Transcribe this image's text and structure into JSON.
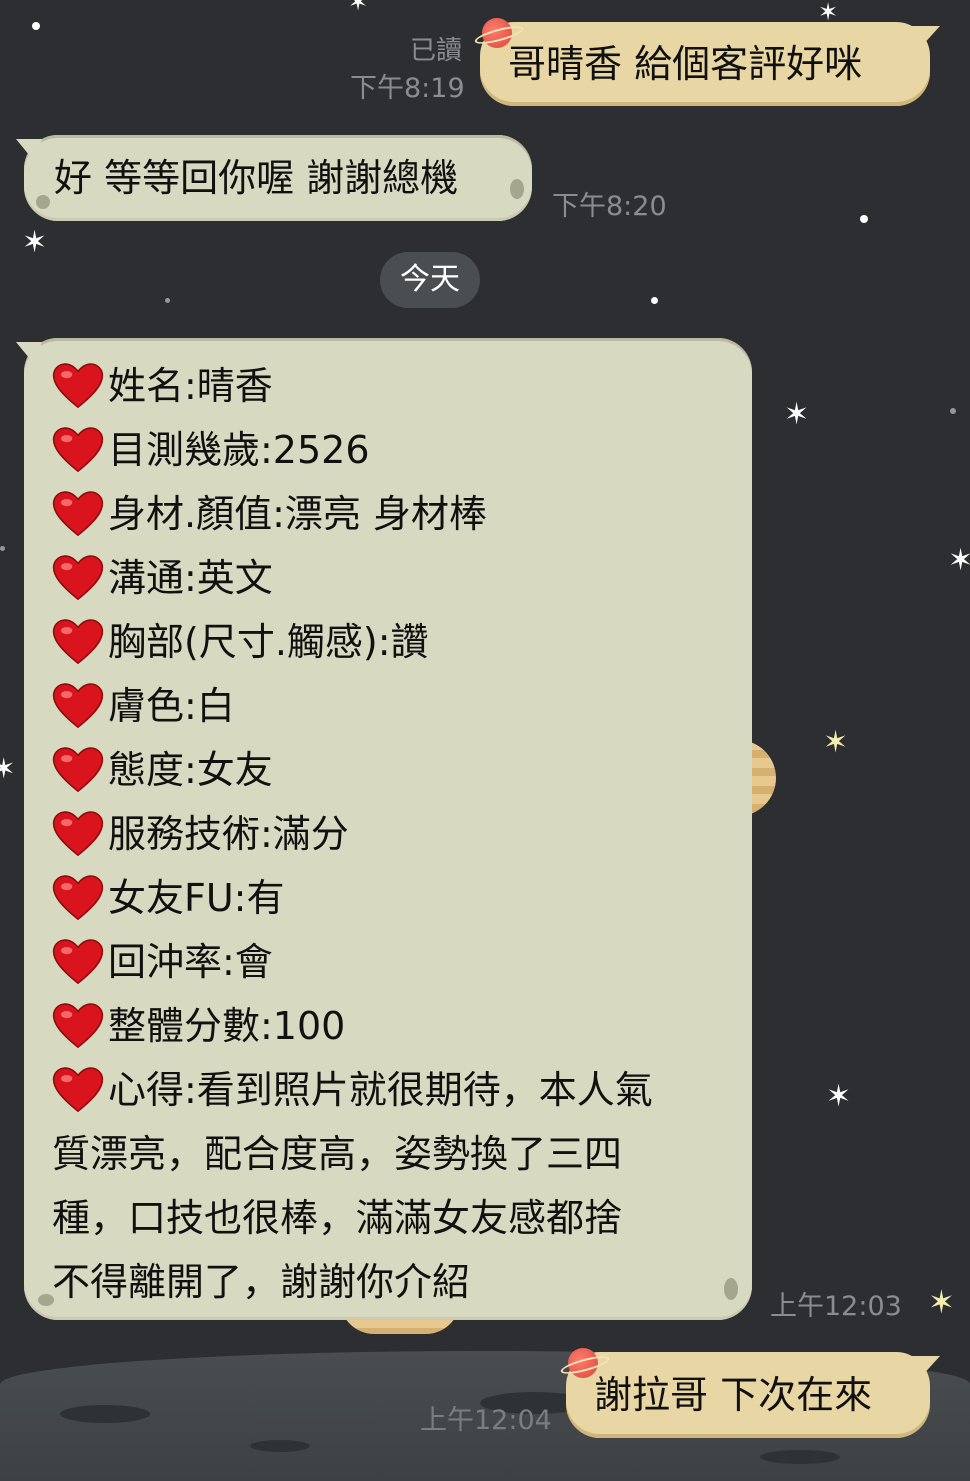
{
  "messages": [
    {
      "text": "哥晴香 給個客評好咪",
      "read": "已讀",
      "time": "下午8:19"
    },
    {
      "text": "好 等等回你喔 謝謝總機",
      "time": "下午8:20"
    },
    {
      "text": "謝拉哥 下次在來",
      "time": "上午12:04"
    }
  ],
  "date_divider": "今天",
  "review": {
    "time": "上午12:03",
    "lines": [
      "姓名:晴香",
      "目測幾歲:2526",
      "身材.顏值:漂亮 身材棒",
      "溝通:英文",
      "胸部(尺寸.觸感):讚",
      "膚色:白",
      "態度:女友",
      "服務技術:滿分",
      "女友FU:有",
      "回沖率:會",
      "整體分數:100",
      "心得:看到照片就很期待，本人氣"
    ],
    "paragraph": [
      "質漂亮，配合度高，姿勢換了三四",
      "種，口技也很棒，滿滿女友感都捨",
      "不得離開了，謝謝你介紹"
    ]
  },
  "colors": {
    "background": "#2c2e31",
    "incoming_bubble": "#d8d9c1",
    "outgoing_bubble": "#e8d7a4",
    "heart": "#d9141c"
  }
}
